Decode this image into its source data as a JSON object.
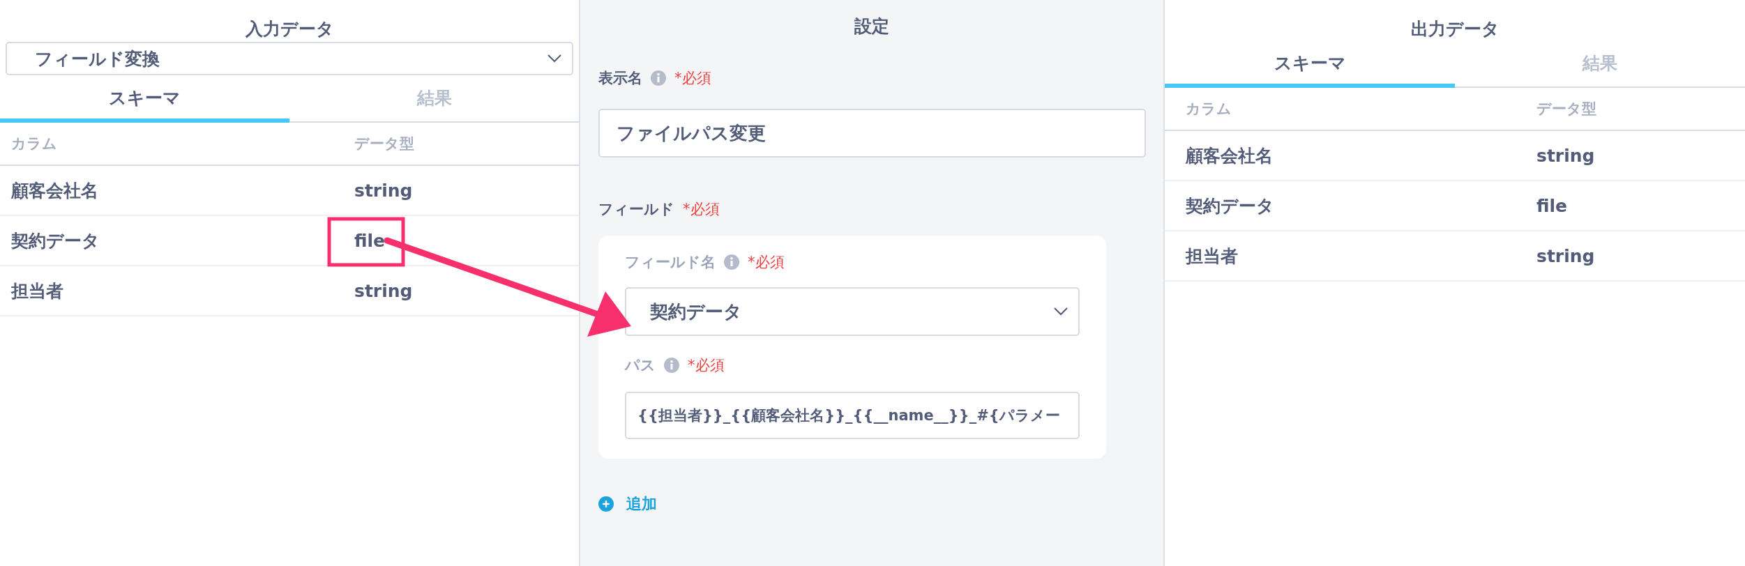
{
  "input_panel": {
    "title": "入力データ",
    "source_select": {
      "value": "フィールド変換"
    },
    "tabs": [
      {
        "label": "スキーマ",
        "selected": true
      },
      {
        "label": "結果",
        "selected": false
      }
    ],
    "table": {
      "columns": [
        "カラム",
        "データ型"
      ],
      "rows": [
        [
          "顧客会社名",
          "string"
        ],
        [
          "契約データ",
          "file"
        ],
        [
          "担当者",
          "string"
        ]
      ]
    }
  },
  "settings_panel": {
    "title": "設定",
    "display_name": {
      "label": "表示名",
      "required": "*必須",
      "value": "ファイルパス変更"
    },
    "fields": {
      "label": "フィールド",
      "required": "*必須",
      "items": [
        {
          "name_label": "フィールド名",
          "name_required": "*必須",
          "name_value": "契約データ",
          "path_label": "パス",
          "path_required": "*必須",
          "path_value": "{{担当者}}_{{顧客会社名}}_{{__name__}}_#{パラメー"
        }
      ]
    },
    "add_button": "追加"
  },
  "output_panel": {
    "title": "出力データ",
    "tabs": [
      {
        "label": "スキーマ",
        "selected": true
      },
      {
        "label": "結果",
        "selected": false
      }
    ],
    "table": {
      "columns": [
        "カラム",
        "データ型"
      ],
      "rows": [
        [
          "顧客会社名",
          "string"
        ],
        [
          "契約データ",
          "file"
        ],
        [
          "担当者",
          "string"
        ]
      ]
    }
  }
}
